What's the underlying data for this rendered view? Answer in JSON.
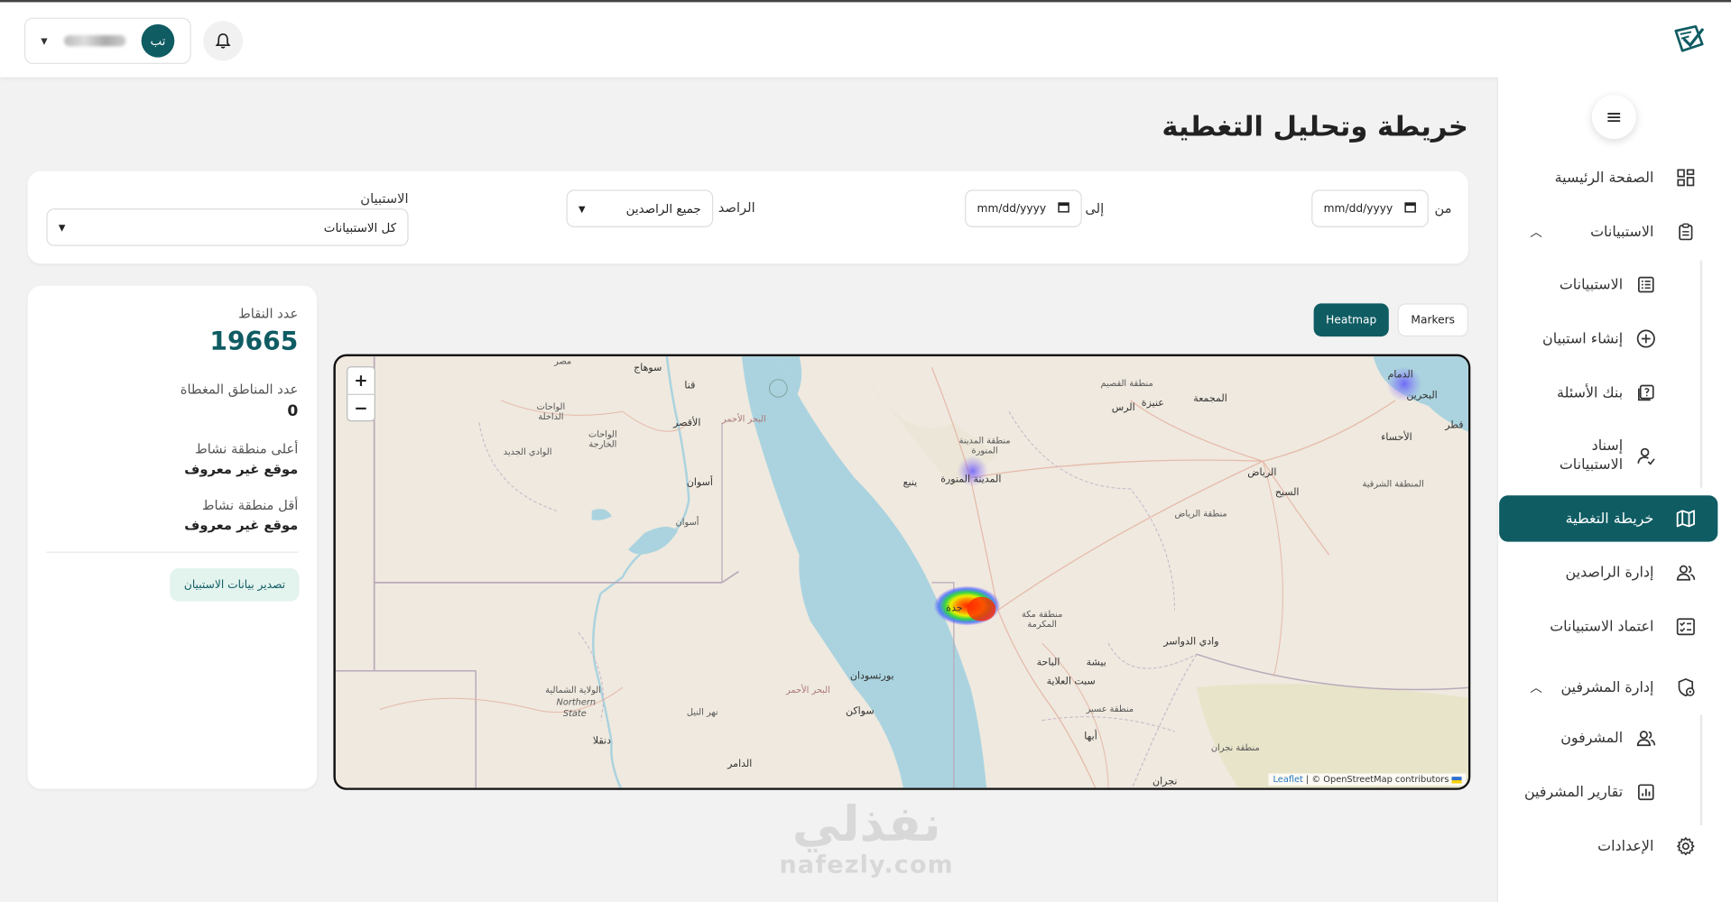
{
  "header": {
    "user_initials": "تب",
    "user_name_hidden": true
  },
  "sidebar": {
    "items": [
      {
        "label": "الصفحة الرئيسية",
        "icon": "dashboard-icon"
      },
      {
        "label": "الاستبيانات",
        "icon": "clipboard-icon"
      },
      {
        "label": "الاستبيانات",
        "icon": "list-icon"
      },
      {
        "label": "إنشاء استبيان",
        "icon": "plus-circle-icon"
      },
      {
        "label": "بنك الأسئلة",
        "icon": "question-icon"
      },
      {
        "label": "إسناد الاستبيانات",
        "icon": "assign-user-icon"
      },
      {
        "label": "خريطة التغطية",
        "icon": "map-icon"
      },
      {
        "label": "إدارة الراصدين",
        "icon": "users-icon"
      },
      {
        "label": "اعتماد الاستبيانات",
        "icon": "checklist-icon"
      },
      {
        "label": "إدارة المشرفين",
        "icon": "shield-icon"
      },
      {
        "label": "المشرفون",
        "icon": "supervisors-icon"
      },
      {
        "label": "تقارير المشرفين",
        "icon": "report-chart-icon"
      },
      {
        "label": "الإعدادات",
        "icon": "gear-icon"
      }
    ],
    "active": "خريطة التغطية"
  },
  "page_title": "خريطة وتحليل التغطية",
  "filters": {
    "from_label": "من",
    "to_label": "إلى",
    "date_placeholder": "mm/dd/yyyy",
    "observer_label": "الراصد",
    "observer_value": "جميع الراصدين",
    "survey_label": "الاستبيان",
    "survey_value": "كل الاستبيانات"
  },
  "stats": {
    "points_label": "عدد النقاط",
    "points_value": "19665",
    "covered_label": "عدد المناطق المغطاة",
    "covered_value": "0",
    "highest_label": "أعلى منطقة نشاط",
    "highest_value": "موقع غير معروف",
    "lowest_label": "أقل منطقة نشاط",
    "lowest_value": "موقع غير معروف",
    "export_label": "تصدير بيانات الاستبيان"
  },
  "map_toggle": {
    "heatmap": "Heatmap",
    "markers": "Markers",
    "active": "Heatmap"
  },
  "map": {
    "zoom_in": "+",
    "zoom_out": "−",
    "attribution_leaflet": "Leaflet",
    "attribution_osm": "| © OpenStreetMap contributors",
    "labels": {
      "egypt": "مصر",
      "sohag": "سوهاج",
      "qena": "قنا",
      "luxor": "الأقصر",
      "red_sea_gov": "البحر الأحمر",
      "dakhla": "الواحات الداخلة",
      "kharga": "الواحات الخارجة",
      "new_valley": "الوادي الجديد",
      "aswan": "أسوان",
      "aswan2": "أسوان",
      "qassim": "منطقة القصيم",
      "majmaah": "المجمعة",
      "dammam": "الدمام",
      "bahrain": "البحرين",
      "qatar": "قطر",
      "ahsa": "الأحساء",
      "rass": "الرس",
      "unaizah": "عنيزة",
      "madinah_region": "منطقة المدينة المنورة",
      "madinah": "المدينة المنورة",
      "yanbu": "ينبع",
      "riyadh": "الرياض",
      "kharj": "السيح",
      "riyadh_region": "منطقة الرياض",
      "eastern": "المنطقة الشرقية",
      "jeddah": "جدة",
      "makkah_region": "منطقة مكة المكرمة",
      "dawasir": "وادي الدواسر",
      "baha": "الباحة",
      "bisha": "بيشة",
      "sabt": "سبت العلاية",
      "asir": "منطقة عسير",
      "abha": "أبها",
      "najran": "منطقة نجران",
      "najran_city": "نجران",
      "port_sudan": "بورتسودان",
      "red_sea_sd": "البحر الأحمر",
      "suakin": "سواكن",
      "northern": "الولاية الشمالية",
      "northern_en": "Northern",
      "state_en": "State",
      "nile": "نهر النيل",
      "dongola": "دنقلا",
      "damer": "الدامر"
    }
  },
  "watermark": {
    "arabic": "نفذلي",
    "latin": "nafezly.com"
  }
}
